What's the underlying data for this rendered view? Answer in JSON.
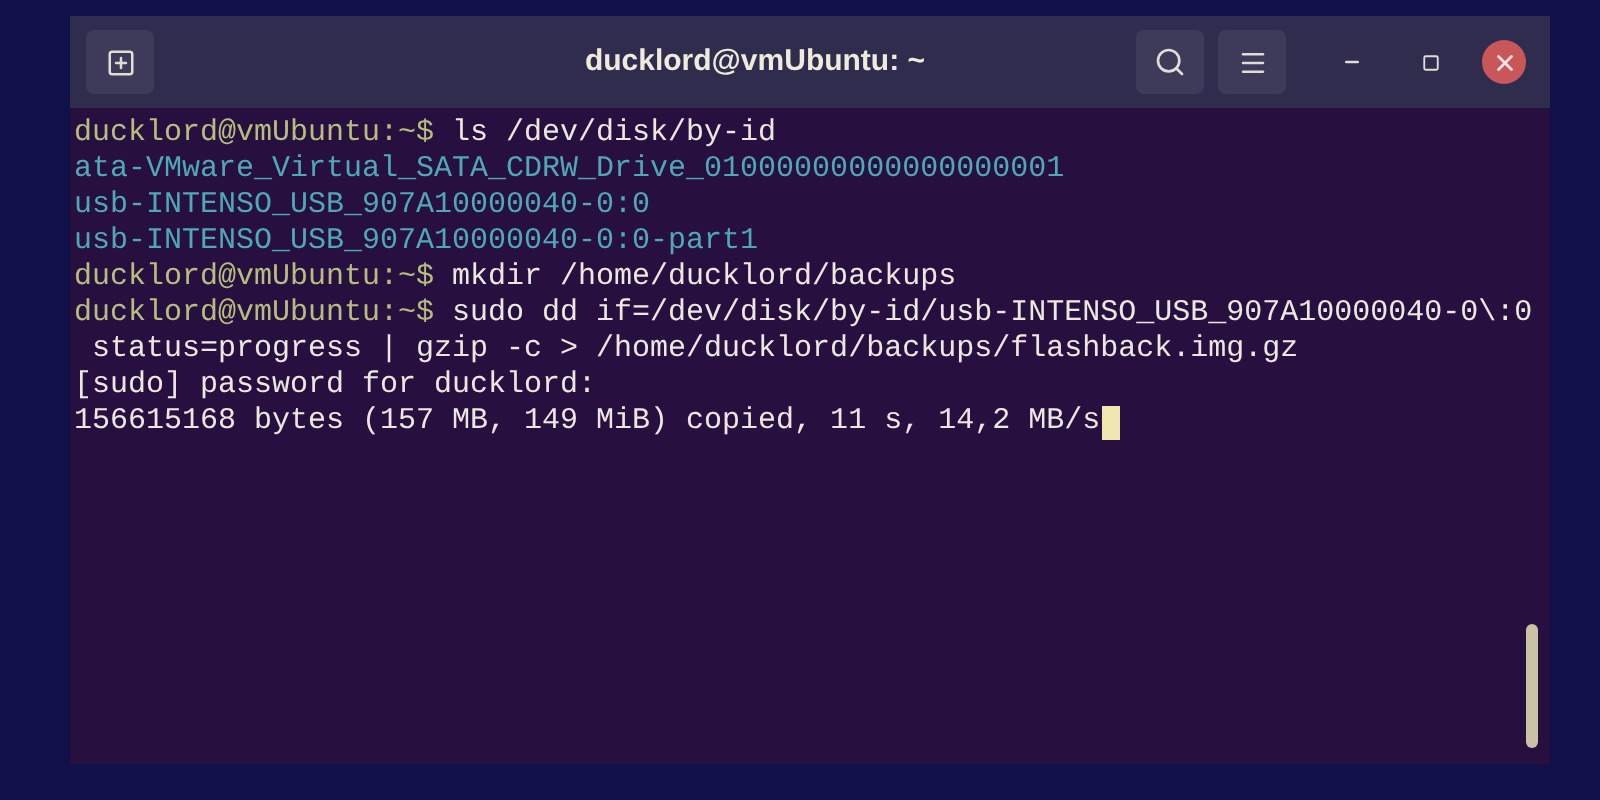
{
  "window": {
    "title": "ducklord@vmUbuntu: ~"
  },
  "terminal": {
    "lines": [
      {
        "kind": "prompt",
        "prompt": "ducklord@vmUbuntu:~$",
        "command": "ls /dev/disk/by-id",
        "cursor": false
      },
      {
        "kind": "entry",
        "text": "ata-VMware_Virtual_SATA_CDRW_Drive_01000000000000000001",
        "cursor": false
      },
      {
        "kind": "entry",
        "text": "usb-INTENSO_USB_907A10000040-0:0",
        "cursor": false
      },
      {
        "kind": "entry",
        "text": "usb-INTENSO_USB_907A10000040-0:0-part1",
        "cursor": false
      },
      {
        "kind": "prompt",
        "prompt": "ducklord@vmUbuntu:~$",
        "command": "mkdir /home/ducklord/backups",
        "cursor": false
      },
      {
        "kind": "prompt",
        "prompt": "ducklord@vmUbuntu:~$",
        "command": "sudo dd if=/dev/disk/by-id/usb-INTENSO_USB_907A10000040-0\\:0",
        "cursor": false
      },
      {
        "kind": "text",
        "text": " status=progress | gzip -c > /home/ducklord/backups/flashback.img.gz",
        "cursor": false
      },
      {
        "kind": "text",
        "text": "[sudo] password for ducklord:",
        "cursor": false
      },
      {
        "kind": "text",
        "text": "156615168 bytes (157 MB, 149 MiB) copied, 11 s, 14,2 MB/s",
        "cursor": true
      }
    ]
  }
}
